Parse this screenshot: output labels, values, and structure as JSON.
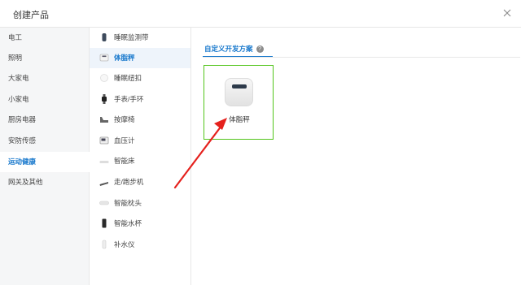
{
  "dialog": {
    "title": "创建产品",
    "close_icon": "close-icon"
  },
  "categories": [
    {
      "label": "电工"
    },
    {
      "label": "照明"
    },
    {
      "label": "大家电"
    },
    {
      "label": "小家电"
    },
    {
      "label": "厨房电器"
    },
    {
      "label": "安防传感"
    },
    {
      "label": "运动健康",
      "active": true
    },
    {
      "label": "网关及其他"
    }
  ],
  "subcategories": [
    {
      "label": "睡眠监测带",
      "icon": "sleep-band-icon"
    },
    {
      "label": "体脂秤",
      "icon": "scale-icon",
      "active": true
    },
    {
      "label": "睡眠纽扣",
      "icon": "sleep-button-icon"
    },
    {
      "label": "手表/手环",
      "icon": "watch-icon"
    },
    {
      "label": "按摩椅",
      "icon": "massage-chair-icon"
    },
    {
      "label": "血压计",
      "icon": "blood-pressure-icon"
    },
    {
      "label": "智能床",
      "icon": "smart-bed-icon"
    },
    {
      "label": "走/跑步机",
      "icon": "treadmill-icon"
    },
    {
      "label": "智能枕头",
      "icon": "pillow-icon"
    },
    {
      "label": "智能水杯",
      "icon": "cup-icon"
    },
    {
      "label": "补水仪",
      "icon": "humidifier-icon"
    }
  ],
  "tab": {
    "label": "自定义开发方案",
    "help_icon": "?"
  },
  "product_card": {
    "label": "体脂秤",
    "screen_text": "",
    "icon": "body-fat-scale-image"
  },
  "colors": {
    "accent": "#1677cc",
    "card_border": "#52c41a",
    "arrow": "#e5211d"
  }
}
